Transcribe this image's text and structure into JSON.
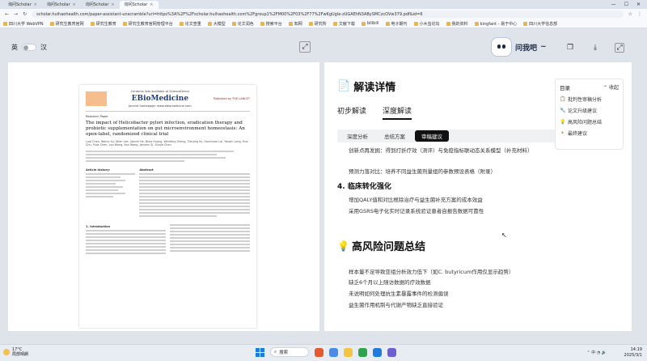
{
  "browser": {
    "tabs": [
      {
        "label": "询问Scholar",
        "active": false
      },
      {
        "label": "询问Scholar",
        "active": false
      },
      {
        "label": "询问Scholar",
        "active": false
      },
      {
        "label": "询问Scholar",
        "active": true
      }
    ],
    "url": "scholar.huihaohealth.com/paper-assistant-unscramble?url=https%3A%2F%2Fscholar.huihaohealth.com%2Fgroup1%2FM00%2F03%2F77%2FwKgUgle-zUGAEhN3ABySMCzcOVw379.pdf&id=6",
    "bookmarks": [
      "四川大学 WebVPN",
      "研究生教育官网",
      "研究生教育",
      "研究生教育官网管理平台",
      "论文查重",
      "大模型",
      "论文润色",
      "搜索平台",
      "知网",
      "研究所",
      "文献下载",
      "bilibili",
      "电子期刊",
      "小木虫论坛",
      "我的资料",
      "kingfant - 易于中心",
      "四川大学信息部"
    ]
  },
  "app": {
    "lang_en": "英",
    "lang_zh": "汉",
    "ask_label": "问我吧",
    "ask_chevron": "~"
  },
  "pdf": {
    "journal_info": "Contents lists available at ScienceDirect",
    "journal_name": "EBioMedicine",
    "publisher": "Published by THE LANCET",
    "journal_homepage": "journal homepage: www.ebiomedicine.com",
    "article_type": "Research Paper",
    "title": "The impact of Helicobacter pylori infection, eradication therapy and probiotic supplementation on gut microenvironment homeostasis: An open-label, randomized clinical trial",
    "authors": "Luqi Chen, Wenxi Xu, Allen Lee, Jianxin He, Bixia Huang, Wenfeng Zheng, Tianjing Su, Sanchuan Lai, Yanqin Long, Hua Chu, Yujia Chen, Lan Wang, Kan Wang, Jianmin Si, Shujie Chen",
    "article_info": "Article history:",
    "abstract": "Abstract",
    "intro": "1. Introduction"
  },
  "panel": {
    "title": "解读详情",
    "tabs": [
      "初步解读",
      "深度解读"
    ],
    "subtabs": [
      "深度分析",
      "总结方案",
      "审稿建议"
    ],
    "para1": "创新点再发掘：得到打折疗效（测评）与免疫指标联动态关系模型（补充材料）",
    "para2": "预测力落对比：培养不同益生菌剂量组的参数预设表格（附录）",
    "section4": "4. 临床转化强化",
    "section4_lines": [
      "增加QALY值和对比根除治疗与益生菌补充方案的成本效益",
      "采用GSRS电子化实时记录系统验证患者自报告数据可靠性"
    ],
    "section5_title": "高风险问题总结",
    "section5_lines": [
      "样本量不足导致亚组分析效力低下（如C. butyricum作用仅显示趋势）",
      "缺乏6个月以上随访数据的疗效数据",
      "未说明如何处理抗生素暴露事件的检测偏误",
      "益生菌作用机制与代谢产物缺乏直接验证"
    ]
  },
  "toc": {
    "title": "目录",
    "collapse": "收起",
    "items": [
      "批判性审稿分析",
      "论文升级建议",
      "高风险问题总结",
      "最终建议"
    ]
  },
  "taskbar": {
    "temp": "17°C",
    "weather": "局部晴朗",
    "search": "搜索",
    "time": "14:19",
    "date": "2025/3/1"
  }
}
